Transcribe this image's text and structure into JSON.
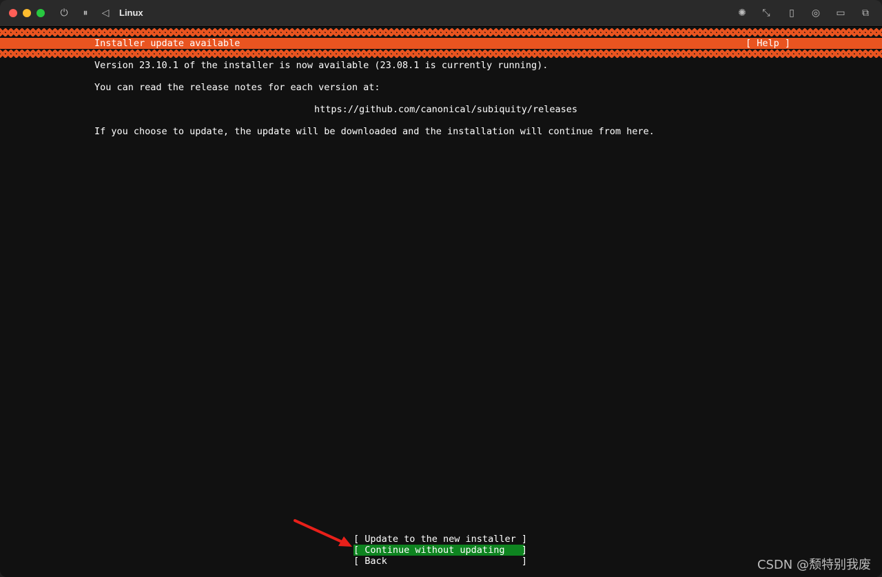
{
  "window": {
    "title": "Linux",
    "toolbar_icons": [
      "power-icon",
      "pause-icon",
      "back-icon",
      "brightness-icon",
      "resize-icon",
      "usb-icon",
      "network-icon",
      "folder-icon",
      "windows-icon"
    ]
  },
  "installer": {
    "header_title": "Installer update available",
    "help_label": "[ Help ]",
    "version_line": "Version 23.10.1 of the installer is now available (23.08.1 is currently running).",
    "notes_line": "You can read the release notes for each version at:",
    "url": "https://github.com/canonical/subiquity/releases",
    "update_line": "If you choose to update, the update will be downloaded and the installation will continue from here.",
    "buttons": [
      {
        "label": "[ Update to the new installer ]",
        "selected": false
      },
      {
        "label": "[ Continue without updating   ]",
        "selected": true
      },
      {
        "label": "[ Back                        ]",
        "selected": false
      }
    ]
  },
  "colors": {
    "accent": "#e95420",
    "selected": "#0e8420"
  },
  "watermark": "CSDN @颓特别我废"
}
